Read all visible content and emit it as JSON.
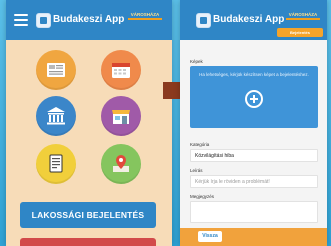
{
  "left_screen": {
    "app_title": "Budakeszi App",
    "brand_tag": "VÁROSHÁZA",
    "tiles": [
      {
        "name": "news-icon",
        "bg": "#f0a640"
      },
      {
        "name": "calendar-icon",
        "bg": "#f08a4b"
      },
      {
        "name": "city-hall-icon",
        "bg": "#3b86c9"
      },
      {
        "name": "shop-icon",
        "bg": "#a05aa8"
      },
      {
        "name": "document-list-icon",
        "bg": "#f1cf3b"
      },
      {
        "name": "map-pin-icon",
        "bg": "#85c55e"
      }
    ],
    "report_button": "LAKOSSÁGI BEJELENTÉS"
  },
  "right_screen": {
    "app_title": "Budakeszi App",
    "brand_tag": "VÁROSHÁZA",
    "tab_label": "Bejelentés",
    "photos_label": "Képek",
    "photos_hint": "Ha lehetséges, kérjük készítsen képet a bejelentéshez.",
    "category_label": "Kategória",
    "category_value": "Közvilágítási hiba",
    "location_label": "Leírás",
    "location_placeholder": "Kérjük írja le röviden a problémát!",
    "comment_label": "Megjegyzés",
    "back_button": "Vissza"
  },
  "colors": {
    "accent_blue": "#2f86c6",
    "left_background": "#f7dcb8",
    "bottom_bar": "#f1a23c"
  }
}
